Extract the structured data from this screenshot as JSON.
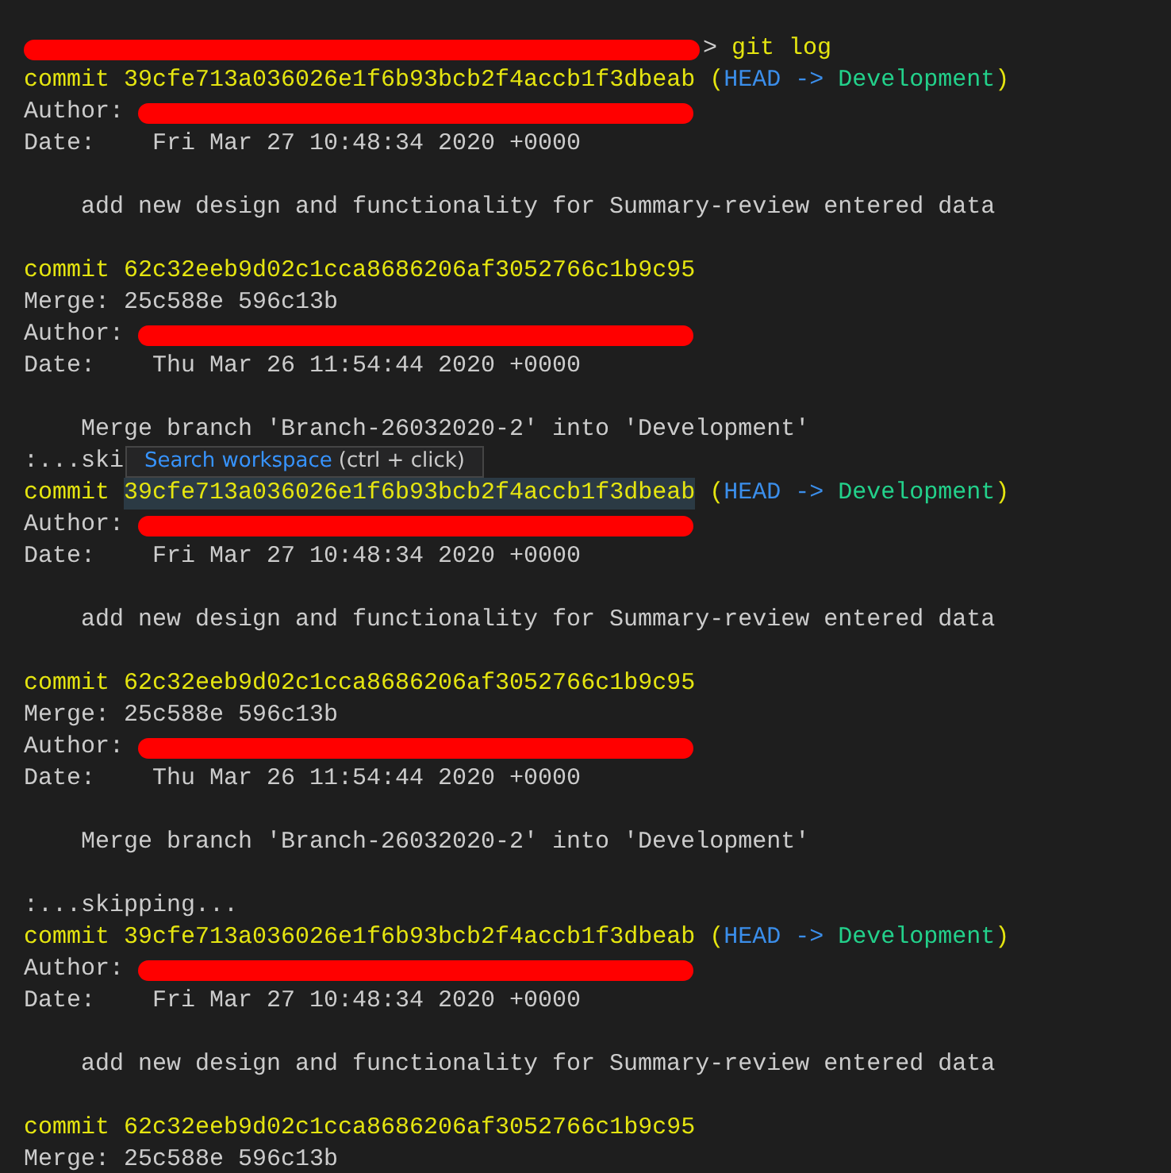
{
  "terminal": {
    "lines": [
      {
        "kind": "prompt",
        "redacted": true,
        "symbol": ">",
        "command": "git log"
      },
      {
        "kind": "commit",
        "label": "commit",
        "hash": "39cfe713a036026e1f6b93bcb2f4accb1f3dbeab",
        "open": "(",
        "head": "HEAD",
        "arrow": "->",
        "branch": "Development",
        "close": ")",
        "hovered": false
      },
      {
        "kind": "author",
        "label": "Author:",
        "redacted": true
      },
      {
        "kind": "date",
        "label": "Date:",
        "value": "Fri Mar 27 10:48:34 2020 +0000"
      },
      {
        "kind": "blank"
      },
      {
        "kind": "message",
        "text": "add new design and functionality for Summary-review entered data"
      },
      {
        "kind": "blank"
      },
      {
        "kind": "commit",
        "label": "commit",
        "hash": "62c32eeb9d02c1cca8686206af3052766c1b9c95",
        "hovered": false
      },
      {
        "kind": "merge",
        "label": "Merge:",
        "value": "25c588e 596c13b"
      },
      {
        "kind": "author",
        "label": "Author:",
        "redacted": true
      },
      {
        "kind": "date",
        "label": "Date:",
        "value": "Thu Mar 26 11:54:44 2020 +0000"
      },
      {
        "kind": "blank"
      },
      {
        "kind": "message",
        "text": "Merge branch 'Branch-26032020-2' into 'Development'"
      },
      {
        "kind": "skipping",
        "text": ":...ski"
      },
      {
        "kind": "commit",
        "label": "commit",
        "hash": "39cfe713a036026e1f6b93bcb2f4accb1f3dbeab",
        "open": "(",
        "head": "HEAD",
        "arrow": "->",
        "branch": "Development",
        "close": ")",
        "hovered": true
      },
      {
        "kind": "author",
        "label": "Author:",
        "redacted": true
      },
      {
        "kind": "date",
        "label": "Date:",
        "value": "Fri Mar 27 10:48:34 2020 +0000"
      },
      {
        "kind": "blank"
      },
      {
        "kind": "message",
        "text": "add new design and functionality for Summary-review entered data"
      },
      {
        "kind": "blank"
      },
      {
        "kind": "commit",
        "label": "commit",
        "hash": "62c32eeb9d02c1cca8686206af3052766c1b9c95",
        "hovered": false
      },
      {
        "kind": "merge",
        "label": "Merge:",
        "value": "25c588e 596c13b"
      },
      {
        "kind": "author",
        "label": "Author:",
        "redacted": true
      },
      {
        "kind": "date",
        "label": "Date:",
        "value": "Thu Mar 26 11:54:44 2020 +0000"
      },
      {
        "kind": "blank"
      },
      {
        "kind": "message",
        "text": "Merge branch 'Branch-26032020-2' into 'Development'"
      },
      {
        "kind": "blank"
      },
      {
        "kind": "skipping",
        "text": ":...skipping..."
      },
      {
        "kind": "commit",
        "label": "commit",
        "hash": "39cfe713a036026e1f6b93bcb2f4accb1f3dbeab",
        "open": "(",
        "head": "HEAD",
        "arrow": "->",
        "branch": "Development",
        "close": ")",
        "hovered": false
      },
      {
        "kind": "author",
        "label": "Author:",
        "redacted": true
      },
      {
        "kind": "date",
        "label": "Date:",
        "value": "Fri Mar 27 10:48:34 2020 +0000"
      },
      {
        "kind": "blank"
      },
      {
        "kind": "message",
        "text": "add new design and functionality for Summary-review entered data"
      },
      {
        "kind": "blank"
      },
      {
        "kind": "commit",
        "label": "commit",
        "hash": "62c32eeb9d02c1cca8686206af3052766c1b9c95",
        "hovered": false
      },
      {
        "kind": "merge",
        "label": "Merge:",
        "value": "25c588e 596c13b"
      }
    ]
  },
  "tooltip": {
    "link": "Search workspace",
    "hint": "(ctrl + click)"
  }
}
